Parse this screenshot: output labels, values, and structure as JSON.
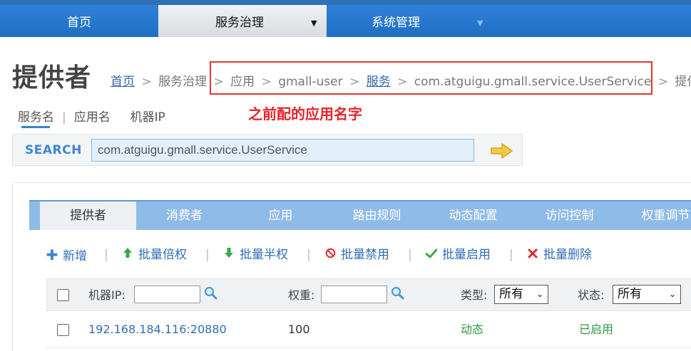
{
  "nav": {
    "items": [
      {
        "label": "首页"
      },
      {
        "label": "服务治理"
      },
      {
        "label": "系统管理"
      }
    ],
    "active_dropdown_glyph": "▼",
    "inactive_dropdown_glyph": "▼"
  },
  "header": {
    "title": "提供者",
    "breadcrumb": {
      "home": "首页",
      "governance": "服务治理",
      "app": "应用",
      "app_name": "gmall-user",
      "service": "服务",
      "service_name": "com.atguigu.gmall.service.UserService",
      "current": "提供者",
      "separator": ">"
    },
    "annotation": "之前配的应用名字"
  },
  "search": {
    "types": [
      "服务名",
      "应用名",
      "机器IP"
    ],
    "type_separator": "|",
    "label": "SEARCH",
    "value": "com.atguigu.gmall.service.UserService"
  },
  "tabs": [
    "提供者",
    "消费者",
    "应用",
    "路由规则",
    "动态配置",
    "访问控制",
    "权重调节"
  ],
  "toolbar": {
    "separator": "|",
    "actions": [
      {
        "label": "新增",
        "icon": "plus-icon"
      },
      {
        "label": "批量倍权",
        "icon": "arrow-up-icon"
      },
      {
        "label": "批量半权",
        "icon": "arrow-down-icon"
      },
      {
        "label": "批量禁用",
        "icon": "ban-icon"
      },
      {
        "label": "批量启用",
        "icon": "check-icon"
      },
      {
        "label": "批量删除",
        "icon": "x-icon"
      }
    ]
  },
  "table": {
    "filters": {
      "ip_label": "机器IP:",
      "weight_label": "权重:",
      "type_label": "类型:",
      "type_value": "所有",
      "status_label": "状态:",
      "status_value": "所有"
    },
    "rows": [
      {
        "address": "192.168.184.116:20880",
        "weight": "100",
        "type": "动态",
        "status": "已启用"
      }
    ]
  },
  "colors": {
    "nav_blue": "#1f6fc6",
    "tab_blue": "#8ebbe7",
    "link_blue": "#2e6db4",
    "green": "#2c9a3e",
    "annotation_red": "#e53333"
  }
}
